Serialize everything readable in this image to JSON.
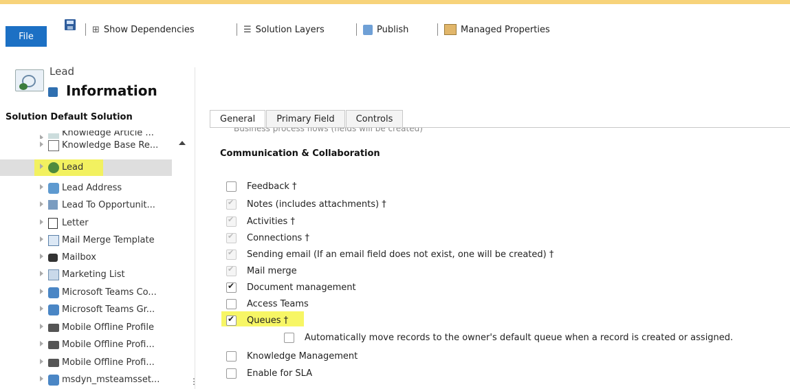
{
  "toolbar": {
    "file_label": "File",
    "show_dependencies": "Show Dependencies",
    "solution_layers": "Solution Layers",
    "publish": "Publish",
    "managed_properties": "Managed Properties"
  },
  "header": {
    "entity_name": "Lead",
    "page_title": "Information"
  },
  "sidebar": {
    "solution_label": "Solution Default Solution",
    "items": [
      {
        "label": "Knowledge Article ..."
      },
      {
        "label": "Knowledge Base Re..."
      },
      {
        "label": "Lead"
      },
      {
        "label": "Lead Address"
      },
      {
        "label": "Lead To Opportunit..."
      },
      {
        "label": "Letter"
      },
      {
        "label": "Mail Merge Template"
      },
      {
        "label": "Mailbox"
      },
      {
        "label": "Marketing List"
      },
      {
        "label": "Microsoft Teams Co..."
      },
      {
        "label": "Microsoft Teams Gr..."
      },
      {
        "label": "Mobile Offline Profile"
      },
      {
        "label": "Mobile Offline Profi..."
      },
      {
        "label": "Mobile Offline Profi..."
      },
      {
        "label": "msdyn_msteamsset..."
      }
    ],
    "scroll_glyph": "⋮"
  },
  "tabs": [
    {
      "label": "General"
    },
    {
      "label": "Primary Field"
    },
    {
      "label": "Controls"
    }
  ],
  "main": {
    "cut_text": "Business process flows (fields will be created)",
    "section_title": "Communication & Collaboration",
    "options": [
      {
        "label": "Feedback †",
        "state": "unchecked"
      },
      {
        "label": "Notes (includes attachments) †",
        "state": "disabled-checked"
      },
      {
        "label": "Activities †",
        "state": "disabled-checked"
      },
      {
        "label": "Connections †",
        "state": "disabled-checked"
      },
      {
        "label": "Sending email (If an email field does not exist, one will be created) †",
        "state": "disabled-checked"
      },
      {
        "label": "Mail merge",
        "state": "disabled-checked"
      },
      {
        "label": "Document management",
        "state": "checked"
      },
      {
        "label": "Access Teams",
        "state": "unchecked"
      },
      {
        "label": "Queues †",
        "state": "checked"
      },
      {
        "label": "Automatically move records to the owner's default queue when a record is created or assigned.",
        "state": "unchecked"
      },
      {
        "label": "Knowledge Management",
        "state": "unchecked"
      },
      {
        "label": "Enable for SLA",
        "state": "unchecked"
      }
    ]
  },
  "colors": {
    "file_button": "#1c70c4",
    "highlight": "#f6f54a",
    "top_line": "#f7d37a"
  }
}
